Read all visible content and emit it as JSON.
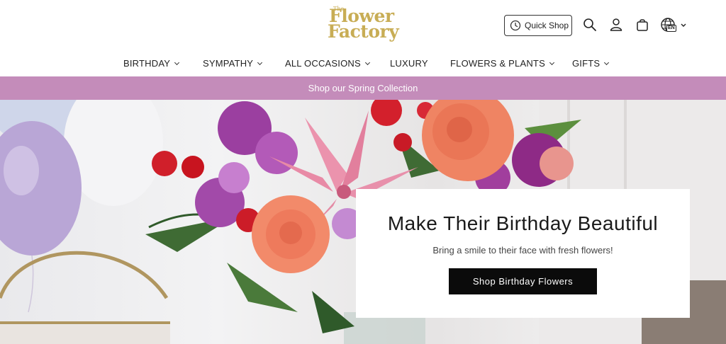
{
  "header": {
    "logo": {
      "small": "The",
      "line1": "Flower",
      "line2": "Factory"
    },
    "quick_shop": {
      "label": "Quick Shop",
      "icon": "clock-icon"
    },
    "icons": [
      "search-icon",
      "account-icon",
      "cart-icon",
      "globe-icon"
    ],
    "language": "EN"
  },
  "nav": {
    "items": [
      {
        "label": "BIRTHDAY",
        "dropdown": true
      },
      {
        "label": "SYMPATHY",
        "dropdown": true
      },
      {
        "label": "ALL OCCASIONS",
        "dropdown": true
      },
      {
        "label": "LUXURY",
        "dropdown": false
      },
      {
        "label": "FLOWERS & PLANTS",
        "dropdown": true
      },
      {
        "label": "GIFTS",
        "dropdown": true
      }
    ]
  },
  "promo": {
    "text": "Shop our Spring Collection"
  },
  "hero": {
    "title": "Make Their Birthday Beautiful",
    "subtitle": "Bring a smile to their face with fresh flowers!",
    "cta": "Shop Birthday Flowers"
  },
  "colors": {
    "brand_gold": "#c8ad55",
    "promo_bar": "#c48cba",
    "cta_bg": "#0b0b0b"
  }
}
